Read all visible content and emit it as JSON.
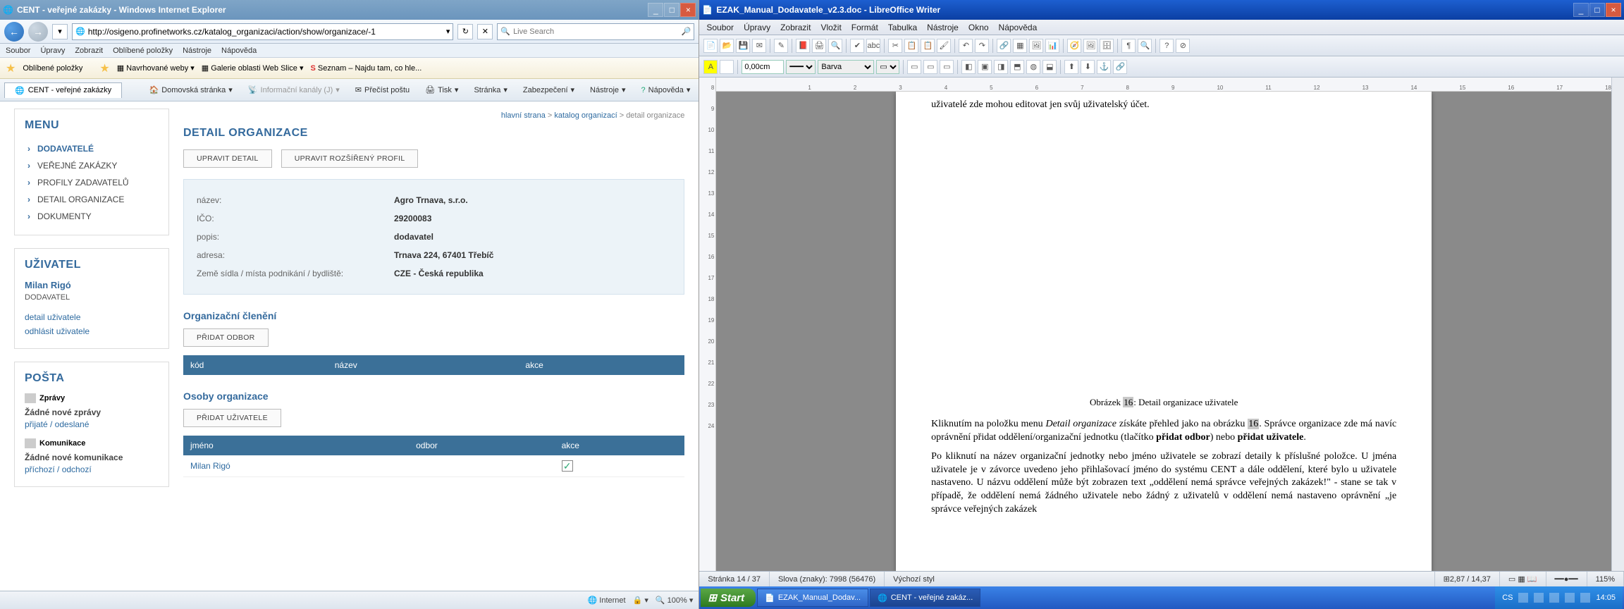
{
  "ie": {
    "title": "CENT - veřejné zakázky - Windows Internet Explorer",
    "url": "http://osigeno.profinetworks.cz/katalog_organizaci/action/show/organizace/-1",
    "search_placeholder": "Live Search",
    "menus": [
      "Soubor",
      "Úpravy",
      "Zobrazit",
      "Oblíbené položky",
      "Nástroje",
      "Nápověda"
    ],
    "fav_label": "Oblíbené položky",
    "fav_items": [
      "Navrhované weby ▾",
      "Galerie oblasti Web Slice ▾",
      "Seznam – Najdu tam, co hle..."
    ],
    "tab": "CENT - veřejné zakázky",
    "cmds": {
      "home": "Domovská stránka",
      "feeds": "Informační kanály (J)",
      "mail": "Přečíst poštu",
      "print": "Tisk",
      "page": "Stránka",
      "safety": "Zabezpečení",
      "tools": "Nástroje",
      "help": "Nápověda"
    },
    "status": {
      "done": "",
      "internet": "Internet",
      "zoom": "100%"
    }
  },
  "page": {
    "menu_title": "MENU",
    "menu_items": [
      "DODAVATELÉ",
      "VEŘEJNÉ ZAKÁZKY",
      "PROFILY ZADAVATELŮ",
      "DETAIL ORGANIZACE",
      "DOKUMENTY"
    ],
    "user_title": "UŽIVATEL",
    "user_name": "Milan Rigó",
    "user_role": "DODAVATEL",
    "user_links": [
      "detail uživatele",
      "odhlásit uživatele"
    ],
    "mail_title": "POŠTA",
    "mail_zpravy": "Zprávy",
    "mail_none": "Žádné nové zprávy",
    "mail_sub": "přijaté / odeslané",
    "komm": "Komunikace",
    "komm_none": "Žádné nové komunikace",
    "komm_sub": "příchozí / odchozí",
    "breadcrumb": [
      "hlavní strana",
      "katalog organizací",
      "detail organizace"
    ],
    "heading": "DETAIL ORGANIZACE",
    "btn_edit": "UPRAVIT DETAIL",
    "btn_ext": "UPRAVIT ROZŠÍŘENÝ PROFIL",
    "rows": [
      {
        "l": "název:",
        "v": "Agro Trnava, s.r.o."
      },
      {
        "l": "IČO:",
        "v": "29200083"
      },
      {
        "l": "popis:",
        "v": "dodavatel"
      },
      {
        "l": "adresa:",
        "v": "Trnava 224, 67401 Třebíč"
      },
      {
        "l": "Země sídla / místa podnikání / bydliště:",
        "v": "CZE - Česká republika"
      }
    ],
    "sec1": "Organizační členění",
    "btn_addodbor": "PŘIDAT ODBOR",
    "tbl1_headers": [
      "kód",
      "název",
      "akce"
    ],
    "sec2": "Osoby organizace",
    "btn_adduser": "PŘIDAT UŽIVATELE",
    "tbl2_headers": [
      "jméno",
      "odbor",
      "akce"
    ],
    "tbl2_row0_name": "Milan Rigó"
  },
  "lo": {
    "title": "EZAK_Manual_Dodavatele_v2.3.doc - LibreOffice Writer",
    "menus": [
      "Soubor",
      "Úpravy",
      "Zobrazit",
      "Vložit",
      "Formát",
      "Tabulka",
      "Nástroje",
      "Okno",
      "Nápověda"
    ],
    "spacing": "0,00cm",
    "barva": "Barva",
    "ruler_h": [
      "1",
      "2",
      "3",
      "4",
      "5",
      "6",
      "7",
      "8",
      "9",
      "10",
      "11",
      "12",
      "13",
      "14",
      "15",
      "16",
      "17",
      "18"
    ],
    "ruler_v": [
      "8",
      "9",
      "10",
      "11",
      "12",
      "13",
      "14",
      "15",
      "16",
      "17",
      "18",
      "19",
      "20",
      "21",
      "22",
      "23",
      "24"
    ],
    "doc_top": "uživatelé zde mohou editovat jen svůj uživatelský účet.",
    "fig_caption_pre": "Obrázek ",
    "fig_num": "16",
    "fig_caption_post": ": Detail organizace uživatele",
    "para1_a": "Kliknutím na položku menu ",
    "para1_i": "Detail organizace",
    "para1_b": " získáte přehled jako na obrázku ",
    "para1_n": "16",
    "para1_c": ". Správce organizace zde má navíc oprávnění přidat oddělení/organizační jednotku (tlačítko ",
    "para1_bold1": "přidat odbor",
    "para1_d": ") nebo ",
    "para1_bold2": "přidat uživatele",
    "para1_e": ".",
    "para2": "Po kliknutí na název organizační jednotky nebo jméno uživatele se zobrazí detaily k příslušné položce. U jména uživatele je v závorce uvedeno jeho přihlašovací jméno do systému CENT a dále oddělení, které bylo u uživatele nastaveno. U názvu oddělení může být zobrazen text „oddělení nemá správce veřejných zakázek!\" - stane se tak v případě, že oddělení nemá žádného uživatele nebo žádný z uživatelů v oddělení nemá nastaveno oprávnění „je správce veřejných zakázek",
    "status": {
      "page": "Stránka 14 / 37",
      "words": "Slova (znaky): 7998 (56476)",
      "style": "Výchozí styl",
      "pos": "2,87 / 14,37",
      "zoom": "115%"
    }
  },
  "taskbar": {
    "start": "Start",
    "items": [
      "EZAK_Manual_Dodav...",
      "CENT - veřejné zakáz..."
    ],
    "lang": "CS",
    "time": "14:05"
  }
}
